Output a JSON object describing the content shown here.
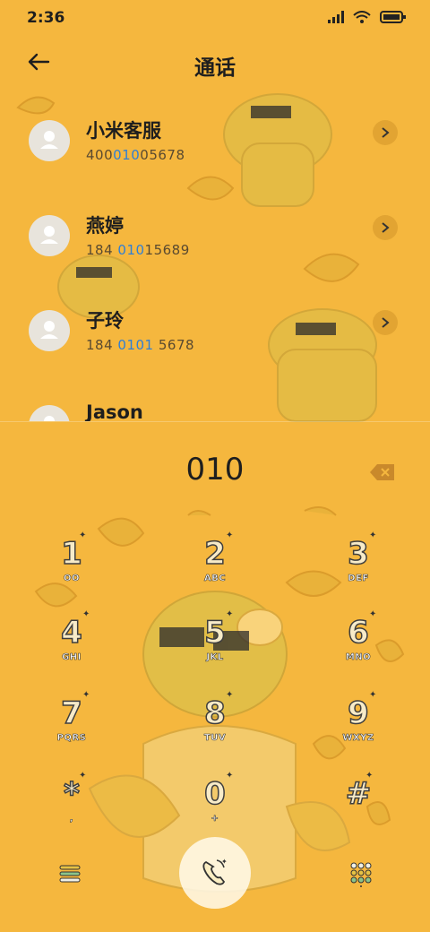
{
  "status": {
    "time": "2:36"
  },
  "header": {
    "title": "通话"
  },
  "contacts": [
    {
      "name": "小米客服",
      "num_pre": "400",
      "num_hl": "010",
      "num_post": "05678"
    },
    {
      "name": "燕婷",
      "num_pre": "184 ",
      "num_hl": "010",
      "num_post": "15689"
    },
    {
      "name": "子玲",
      "num_pre": "184 ",
      "num_hl": "0101",
      "num_post": " 5678"
    },
    {
      "name": "Jason",
      "num_pre": "",
      "num_hl": "",
      "num_post": ""
    }
  ],
  "dialer": {
    "number": "010",
    "keys": [
      {
        "digit": "1",
        "letters": "OO"
      },
      {
        "digit": "2",
        "letters": "ABC"
      },
      {
        "digit": "3",
        "letters": "DEF"
      },
      {
        "digit": "4",
        "letters": "GHI"
      },
      {
        "digit": "5",
        "letters": "JKL"
      },
      {
        "digit": "6",
        "letters": "MNO"
      },
      {
        "digit": "7",
        "letters": "PQRS"
      },
      {
        "digit": "8",
        "letters": "TUV"
      },
      {
        "digit": "9",
        "letters": "WXYZ"
      },
      {
        "digit": "*",
        "letters": ","
      },
      {
        "digit": "0",
        "letters": "+"
      },
      {
        "digit": "#",
        "letters": ""
      }
    ]
  },
  "icons": {
    "back": "arrow-left-icon",
    "chevron": "chevron-right-icon",
    "backspace": "backspace-icon",
    "call": "phone-call-icon",
    "menu": "menu-icon",
    "keypad": "dialpad-icon"
  },
  "colors": {
    "background": "#F5B73E",
    "highlight": "#2f7fd6"
  }
}
